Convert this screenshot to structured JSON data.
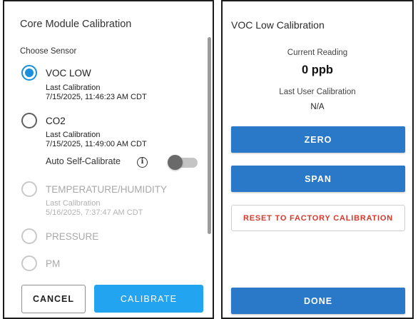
{
  "left_panel": {
    "title": "Core Module Calibration",
    "section_label": "Choose Sensor",
    "options": [
      {
        "label": "VOC LOW",
        "checked": true,
        "enabled": true,
        "last_label": "Last Calibration",
        "last_value": "7/15/2025, 11:46:23 AM CDT"
      },
      {
        "label": "CO2",
        "checked": false,
        "enabled": true,
        "last_label": "Last Calibration",
        "last_value": "7/15/2025, 11:49:00 AM CDT"
      },
      {
        "label": "TEMPERATURE/HUMIDITY",
        "checked": false,
        "enabled": false,
        "last_label": "Last Calibration",
        "last_value": "5/16/2025, 7:37:47 AM CDT"
      },
      {
        "label": "PRESSURE",
        "checked": false,
        "enabled": false
      },
      {
        "label": "PM",
        "checked": false,
        "enabled": false
      }
    ],
    "auto_self_calibrate": {
      "label": "Auto Self-Calibrate",
      "info_icon": "info-icon",
      "enabled": false
    },
    "cancel_label": "CANCEL",
    "calibrate_label": "CALIBRATE"
  },
  "right_panel": {
    "title": "VOC Low Calibration",
    "current_reading_label": "Current Reading",
    "current_reading_value": "0 ppb",
    "last_user_calibration_label": "Last User Calibration",
    "last_user_calibration_value": "N/A",
    "zero_label": "ZERO",
    "span_label": "SPAN",
    "reset_label": "RESET TO FACTORY CALIBRATION",
    "done_label": "DONE"
  },
  "colors": {
    "accent": "#22a4f0",
    "radio_checked": "#1a8fdc",
    "primary_button": "#2979c8",
    "reset_text": "#d33a2c",
    "disabled_text": "#a9a9a9"
  }
}
